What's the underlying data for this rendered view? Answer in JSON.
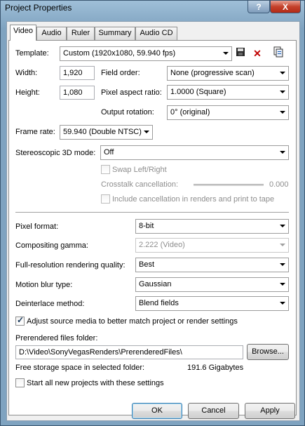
{
  "window": {
    "title": "Project Properties",
    "help_button": "?",
    "close_button": "X"
  },
  "tabs": [
    {
      "label": "Video"
    },
    {
      "label": "Audio"
    },
    {
      "label": "Ruler"
    },
    {
      "label": "Summary"
    },
    {
      "label": "Audio CD"
    }
  ],
  "video": {
    "template_label": "Template:",
    "template_value": "Custom (1920x1080, 59.940 fps)",
    "width_label": "Width:",
    "width_value": "1,920",
    "height_label": "Height:",
    "height_value": "1,080",
    "field_order_label": "Field order:",
    "field_order_value": "None (progressive scan)",
    "pixel_aspect_label": "Pixel aspect ratio:",
    "pixel_aspect_value": "1.0000 (Square)",
    "output_rotation_label": "Output rotation:",
    "output_rotation_value": "0° (original)",
    "frame_rate_label": "Frame rate:",
    "frame_rate_value": "59.940 (Double NTSC)",
    "stereo_label": "Stereoscopic 3D mode:",
    "stereo_value": "Off",
    "swap_label": "Swap Left/Right",
    "crosstalk_label": "Crosstalk cancellation:",
    "crosstalk_value": "0.000",
    "include_cancel_label": "Include cancellation in renders and print to tape",
    "pixel_format_label": "Pixel format:",
    "pixel_format_value": "8-bit",
    "gamma_label": "Compositing gamma:",
    "gamma_value": "2.222 (Video)",
    "render_quality_label": "Full-resolution rendering quality:",
    "render_quality_value": "Best",
    "motion_blur_label": "Motion blur type:",
    "motion_blur_value": "Gaussian",
    "deinterlace_label": "Deinterlace method:",
    "deinterlace_value": "Blend fields",
    "adjust_source_label": "Adjust source media to better match project or render settings",
    "adjust_source_checked": true,
    "prerendered_label": "Prerendered files folder:",
    "prerendered_value": "D:\\Video\\SonyVegasRenders\\PrerenderedFiles\\",
    "browse_label": "Browse...",
    "free_storage_label": "Free storage space in selected folder:",
    "free_storage_value": "191.6 Gigabytes",
    "start_all_label": "Start all new projects with these settings",
    "start_all_checked": false
  },
  "icons": {
    "save": "save-icon",
    "delete": "delete-icon",
    "match_media": "match-media-icon"
  },
  "buttons": {
    "ok": "OK",
    "cancel": "Cancel",
    "apply": "Apply"
  }
}
